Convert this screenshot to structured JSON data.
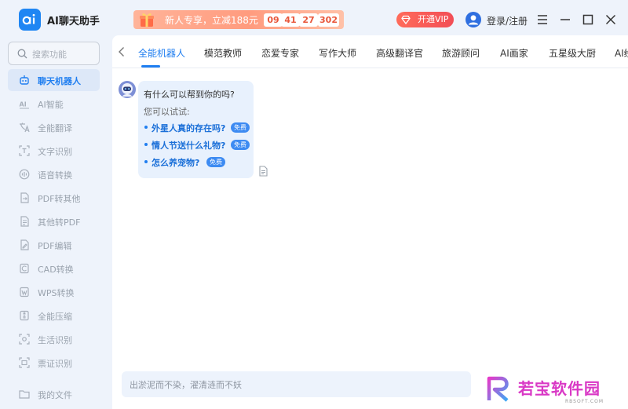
{
  "app": {
    "name": "AI聊天助手"
  },
  "promo": {
    "text": "新人专享，立减188元",
    "timer": {
      "h": "09",
      "m": "41",
      "s": "27",
      "ms": "302",
      "sep": ":"
    }
  },
  "header": {
    "vip_label": "开通VIP",
    "login_label": "登录/注册"
  },
  "sidebar": {
    "search_placeholder": "搜索功能",
    "items": [
      {
        "label": "聊天机器人",
        "icon": "robot-icon",
        "active": true
      },
      {
        "label": "AI智能",
        "icon": "ai-icon"
      },
      {
        "label": "全能翻译",
        "icon": "translate-icon"
      },
      {
        "label": "文字识别",
        "icon": "text-scan-icon"
      },
      {
        "label": "语音转换",
        "icon": "voice-icon"
      },
      {
        "label": "PDF转其他",
        "icon": "pdf-convert-icon"
      },
      {
        "label": "其他转PDF",
        "icon": "to-pdf-icon"
      },
      {
        "label": "PDF编辑",
        "icon": "pdf-edit-icon"
      },
      {
        "label": "CAD转换",
        "icon": "cad-icon"
      },
      {
        "label": "WPS转换",
        "icon": "wps-icon"
      },
      {
        "label": "全能压缩",
        "icon": "compress-icon"
      },
      {
        "label": "生活识别",
        "icon": "life-scan-icon"
      },
      {
        "label": "票证识别",
        "icon": "ticket-scan-icon"
      },
      {
        "label": "我的文件",
        "icon": "folder-icon"
      }
    ]
  },
  "tabs": [
    {
      "label": "全能机器人",
      "active": true
    },
    {
      "label": "模范教师"
    },
    {
      "label": "恋爱专家"
    },
    {
      "label": "写作大师"
    },
    {
      "label": "高级翻译官"
    },
    {
      "label": "旅游顾问"
    },
    {
      "label": "AI画家"
    },
    {
      "label": "五星级大厨"
    },
    {
      "label": "AI绘"
    }
  ],
  "chat": {
    "question": "有什么可以帮到你的吗?",
    "try_label": "您可以试试:",
    "suggestions": [
      {
        "text": "外星人真的存在吗?",
        "badge": "免费"
      },
      {
        "text": "情人节送什么礼物?",
        "badge": "免费"
      },
      {
        "text": "怎么养宠物?",
        "badge": "免费"
      }
    ]
  },
  "input": {
    "placeholder": "出淤泥而不染，濯清涟而不妖"
  },
  "watermark": {
    "text": "若宝软件园",
    "sub": "RBSOFT.COM"
  },
  "colors": {
    "accent": "#1f7ef0",
    "promo": "#ff9b7e",
    "vip": "#f24d56"
  }
}
